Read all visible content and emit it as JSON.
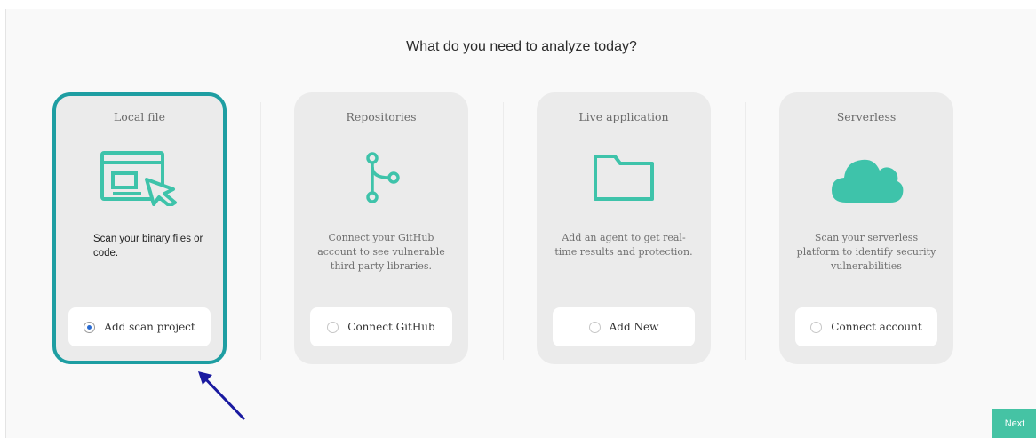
{
  "page": {
    "heading": "What do you need to analyze today?",
    "next_label": "Next"
  },
  "cards": [
    {
      "title": "Local file",
      "icon": "window-cursor-icon",
      "description": "Scan your binary files or code.",
      "button_label": "Add scan project",
      "selected": true
    },
    {
      "title": "Repositories",
      "icon": "git-branch-icon",
      "description": "Connect your GitHub account to see vulnerable third party libraries.",
      "button_label": "Connect GitHub",
      "selected": false
    },
    {
      "title": "Live application",
      "icon": "folder-icon",
      "description": "Add an agent to get real-time results and protection.",
      "button_label": "Add New",
      "selected": false
    },
    {
      "title": "Serverless",
      "icon": "cloud-icon",
      "description": "Scan your serverless platform to identify security vulnerabilities",
      "button_label": "Connect account",
      "selected": false
    }
  ],
  "colors": {
    "accent": "#3ec3aa",
    "selected_border": "#1e9ea2",
    "next_button": "#45c3a4",
    "annotation_arrow": "#1a1aa0"
  }
}
